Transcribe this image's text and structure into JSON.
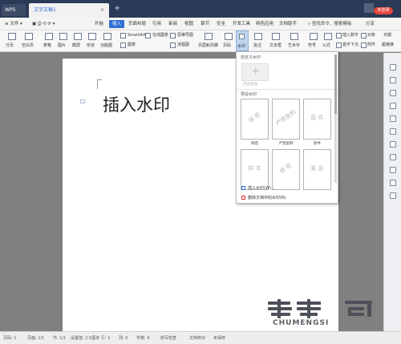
{
  "titlebar": {
    "app_tab": "WPS",
    "doc_tab": "文字文稿1",
    "login": "未登录"
  },
  "menu": {
    "file": "文件",
    "items": [
      "开始",
      "插入",
      "页面布局",
      "引用",
      "审阅",
      "视图",
      "章节",
      "安全",
      "开发工具",
      "特色应用",
      "文档助手"
    ],
    "active": "插入",
    "right_items": [
      "查找命令、搜索模板",
      "分享"
    ]
  },
  "toolbar": {
    "labels": {
      "page_break": "分页",
      "blank_page": "空白页",
      "table": "表格",
      "picture": "图片",
      "screenshot": "截屏",
      "shape": "形状",
      "function_chart": "功能图",
      "smartart": "SmartArt",
      "chart": "图表",
      "online_chart": "在线图表",
      "mind_map": "思维导图",
      "flowchart": "流程图",
      "header_footer": "页眉和页脚",
      "page_number": "页码",
      "watermark": "水印",
      "comment": "批注",
      "textbox": "文本框",
      "wordart": "艺术字",
      "symbol": "符号",
      "formula": "公式",
      "insert_number": "插入数字",
      "object": "对象",
      "date": "日期",
      "first_drop_cap": "首字下沉",
      "attachment": "附件",
      "hyperlink": "超链接"
    }
  },
  "document": {
    "title": "插入水印"
  },
  "watermark_menu": {
    "custom_header": "自定义水印",
    "add_label": "点击添加",
    "preset_header": "预设水印",
    "presets": [
      {
        "text": "保 密",
        "caption": "保密"
      },
      {
        "text": "严禁复制",
        "caption": "严禁复制"
      },
      {
        "text": "原 件",
        "caption": "原件"
      },
      {
        "text": "样 本",
        "caption": ""
      },
      {
        "text": "绝 密",
        "caption": ""
      },
      {
        "text": "紧 急",
        "caption": ""
      }
    ],
    "insert_action": "插入水印(W)...",
    "delete_action": "删除文档中的水印(R)"
  },
  "statusbar": {
    "items": [
      "页码: 1",
      "页面: 1/1",
      "节: 1/1",
      "设置值: 2.5厘米",
      "行: 1",
      "列: 5",
      "字数: 4",
      "拼写检查",
      "文档校对",
      "未保存"
    ]
  },
  "logo": {
    "text": "CHUMENGSI"
  }
}
